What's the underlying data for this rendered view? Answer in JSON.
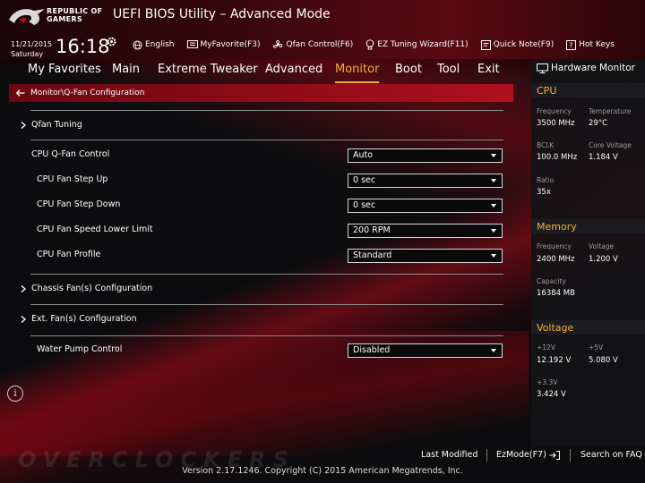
{
  "brand": {
    "line1": "REPUBLIC OF",
    "line2": "GAMERS"
  },
  "window_title": "UEFI BIOS Utility – Advanced Mode",
  "datetime": {
    "date": "11/21/2015",
    "day": "Saturday",
    "time": "16:18"
  },
  "topbar": {
    "language": "English",
    "myfavorite": "MyFavorite(F3)",
    "qfan": "Qfan Control(F6)",
    "ez_tuning": "EZ Tuning Wizard(F11)",
    "quick_note": "Quick Note(F9)",
    "hot_keys": "Hot Keys"
  },
  "tabs": [
    "My Favorites",
    "Main",
    "Extreme Tweaker",
    "Advanced",
    "Monitor",
    "Boot",
    "Tool",
    "Exit"
  ],
  "active_tab": "Monitor",
  "breadcrumb": "Monitor\\Q-Fan Configuration",
  "settings": {
    "qfan_tuning": "Qfan Tuning",
    "cpu_qfan_control": {
      "label": "CPU Q-Fan Control",
      "value": "Auto"
    },
    "cpu_fan_step_up": {
      "label": "CPU Fan Step Up",
      "value": "0 sec"
    },
    "cpu_fan_step_down": {
      "label": "CPU Fan Step Down",
      "value": "0 sec"
    },
    "cpu_fan_speed_lower_limit": {
      "label": "CPU Fan Speed Lower Limit",
      "value": "200 RPM"
    },
    "cpu_fan_profile": {
      "label": "CPU Fan Profile",
      "value": "Standard"
    },
    "chassis_fans": "Chassis Fan(s) Configuration",
    "ext_fans": "Ext. Fan(s) Configuration",
    "water_pump": {
      "label": "Water Pump Control",
      "value": "Disabled"
    }
  },
  "hardware_monitor": {
    "title": "Hardware Monitor",
    "cpu": {
      "heading": "CPU",
      "frequency_label": "Frequency",
      "frequency": "3500 MHz",
      "temperature_label": "Temperature",
      "temperature": "29°C",
      "bclk_label": "BCLK",
      "bclk": "100.0 MHz",
      "core_voltage_label": "Core Voltage",
      "core_voltage": "1.184 V",
      "ratio_label": "Ratio",
      "ratio": "35x"
    },
    "memory": {
      "heading": "Memory",
      "frequency_label": "Frequency",
      "frequency": "2400 MHz",
      "voltage_label": "Voltage",
      "voltage": "1.200 V",
      "capacity_label": "Capacity",
      "capacity": "16384 MB"
    },
    "voltage": {
      "heading": "Voltage",
      "v12_label": "+12V",
      "v12": "12.192 V",
      "v5_label": "+5V",
      "v5": "5.080 V",
      "v33_label": "+3.3V",
      "v33": "3.424 V"
    }
  },
  "footer": {
    "last_modified": "Last Modified",
    "ezmode": "EzMode(F7)",
    "search_faq": "Search on FAQ",
    "version": "Version 2.17.1246. Copyright (C) 2015 American Megatrends, Inc."
  },
  "colors": {
    "accent": "#f0b038",
    "red": "#b0101e"
  }
}
